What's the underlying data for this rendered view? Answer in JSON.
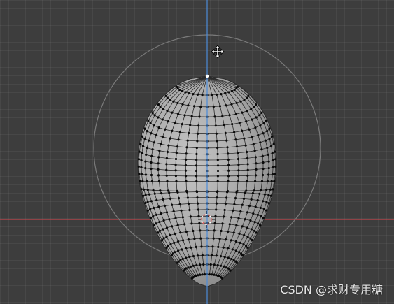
{
  "viewport": {
    "watermark": "CSDN @求财专用糖"
  },
  "colors": {
    "background": "#3d3d3d",
    "x_axis": "#c2454d",
    "z_axis": "#4c8cd9",
    "mesh_fill": "#a9a9a9",
    "mesh_wire": "#2a2a2a",
    "vertex": "#0a0a0a",
    "selected_vertex": "#ffffff",
    "rotate_gizmo": "#7a7a7a",
    "cursor_red": "#e05555"
  },
  "icons": {
    "move_cursor": "move-cursor-icon",
    "3d_cursor": "3d-cursor-icon"
  }
}
